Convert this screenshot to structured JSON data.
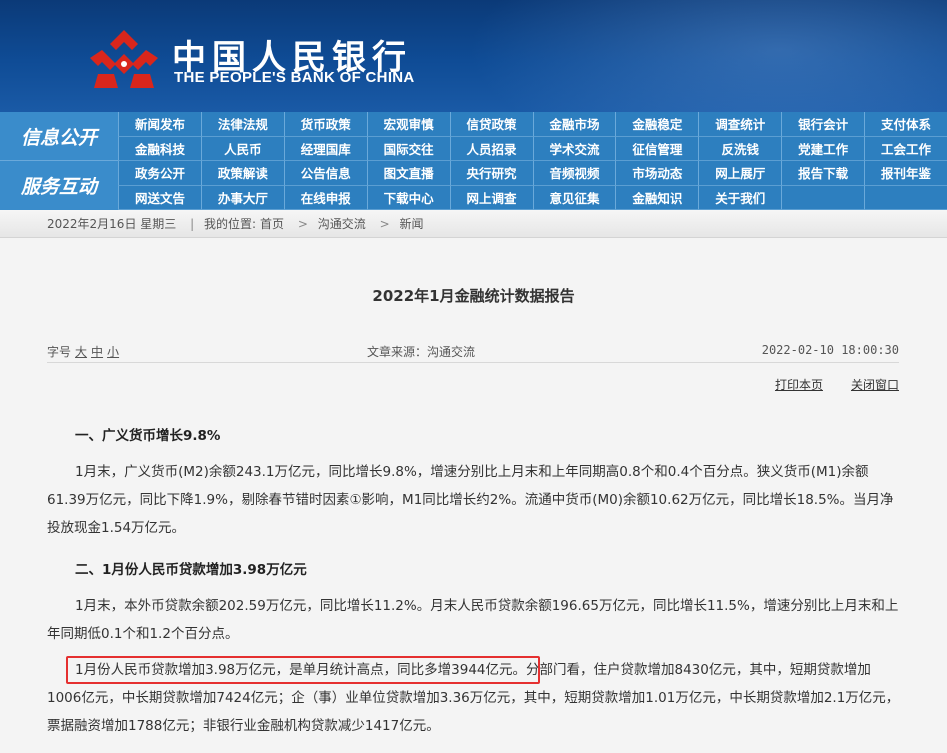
{
  "header": {
    "logo_cn": "中国人民银行",
    "logo_en": "THE PEOPLE'S BANK OF CHINA"
  },
  "nav": {
    "side_labels": [
      "信息公开",
      "服务互动"
    ],
    "rows": [
      [
        "新闻发布",
        "法律法规",
        "货币政策",
        "宏观审慎",
        "信贷政策",
        "金融市场",
        "金融稳定",
        "调查统计",
        "银行会计",
        "支付体系"
      ],
      [
        "金融科技",
        "人民币",
        "经理国库",
        "国际交往",
        "人员招录",
        "学术交流",
        "征信管理",
        "反洗钱",
        "党建工作",
        "工会工作"
      ],
      [
        "政务公开",
        "政策解读",
        "公告信息",
        "图文直播",
        "央行研究",
        "音频视频",
        "市场动态",
        "网上展厅",
        "报告下载",
        "报刊年鉴"
      ],
      [
        "网送文告",
        "办事大厅",
        "在线申报",
        "下载中心",
        "网上调查",
        "意见征集",
        "金融知识",
        "关于我们",
        "",
        ""
      ]
    ]
  },
  "breadcrumb": {
    "date": "2022年2月16日 星期三",
    "sep": "|",
    "prefix": "我的位置:",
    "home": "首页",
    "arrow1": ">",
    "section": "沟通交流",
    "arrow2": ">",
    "page": "新闻"
  },
  "article": {
    "title": "2022年1月金融统计数据报告",
    "font_size_label": "字号",
    "font_sizes": [
      "大",
      "中",
      "小"
    ],
    "source": "文章来源：沟通交流",
    "datetime": "2022-02-10 18:00:30",
    "print_label": "打印本页",
    "close_label": "关闭窗口",
    "heading1": "一、广义货币增长9.8%",
    "para1": "1月末，广义货币(M2)余额243.1万亿元，同比增长9.8%，增速分别比上月末和上年同期高0.8个和0.4个百分点。狭义货币(M1)余额61.39万亿元，同比下降1.9%，剔除春节错时因素①影响，M1同比增长约2%。流通中货币(M0)余额10.62万亿元，同比增长18.5%。当月净投放现金1.54万亿元。",
    "heading2": "二、1月份人民币贷款增加3.98万亿元",
    "para2": "1月末，本外币贷款余额202.59万亿元，同比增长11.2%。月末人民币贷款余额196.65万亿元，同比增长11.5%，增速分别比上月末和上年同期低0.1个和1.2个百分点。",
    "para3": "1月份人民币贷款增加3.98万亿元，是单月统计高点，同比多增3944亿元。分部门看，住户贷款增加8430亿元，其中，短期贷款增加1006亿元，中长期贷款增加7424亿元；企（事）业单位贷款增加3.36万亿元，其中，短期贷款增加1.01万亿元，中长期贷款增加2.1万亿元，票据融资增加1788亿元；非银行业金融机构贷款减少1417亿元。"
  },
  "colors": {
    "banner": "#0f4c96",
    "nav": "#2d7fbf",
    "logo_red": "#d9261c",
    "highlight_border": "#e53030"
  }
}
